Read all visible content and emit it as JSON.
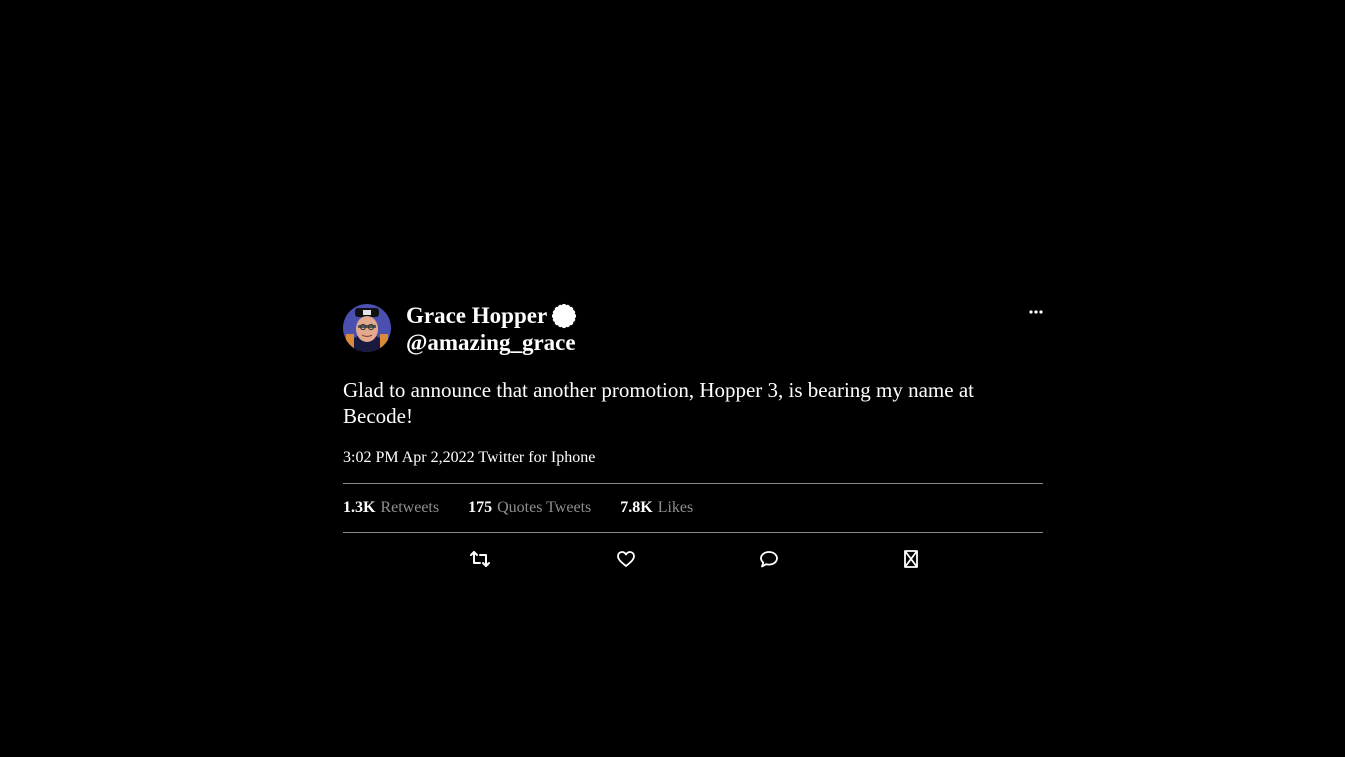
{
  "tweet": {
    "author": {
      "display_name": "Grace Hopper",
      "handle": "@amazing_grace",
      "avatar_icon": "avatar-grace-hopper",
      "verified_icon": "verified-badge-icon"
    },
    "text": "Glad to announce that another promotion, Hopper 3, is bearing my name at Becode!",
    "meta": "3:02 PM Apr 2,2022 Twitter for Iphone",
    "stats": [
      {
        "value": "1.3K",
        "label": "Retweets"
      },
      {
        "value": "175",
        "label": "Quotes Tweets"
      },
      {
        "value": "7.8K",
        "label": "Likes"
      }
    ],
    "actions": [
      "retweet-icon",
      "like-icon",
      "reply-icon",
      "bookmark-icon"
    ],
    "more_icon": "more-options-icon"
  },
  "colors": {
    "background": "#000000",
    "text": "#ffffff",
    "muted": "#8f8f8f",
    "divider": "#8a8a8a"
  }
}
